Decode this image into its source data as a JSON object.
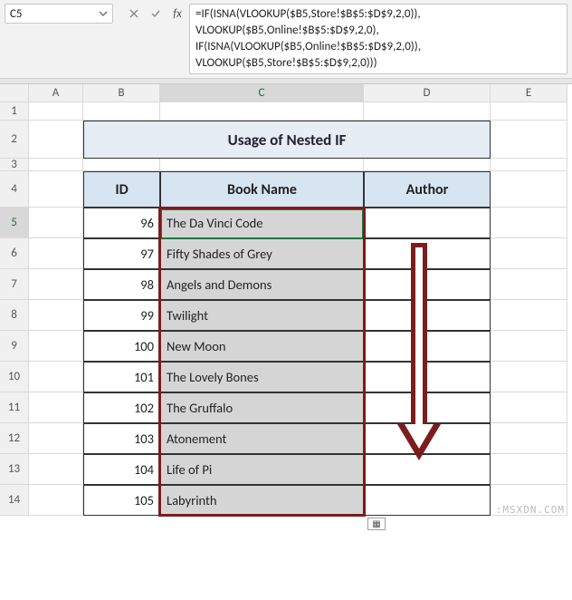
{
  "formula_bar": {
    "cell_ref": "C5",
    "formula": "=IF(ISNA(VLOOKUP($B5,Store!$B$5:$D$9,2,0)),\nVLOOKUP($B5,Online!$B$5:$D$9,2,0),\nIF(ISNA(VLOOKUP($B5,Online!$B$5:$D$9,2,0)),\nVLOOKUP($B5,Store!$B$5:$D$9,2,0)))"
  },
  "columns": [
    "A",
    "B",
    "C",
    "D",
    "E"
  ],
  "row_labels": [
    "1",
    "2",
    "3",
    "4",
    "5",
    "6",
    "7",
    "8",
    "9",
    "10",
    "11",
    "12",
    "13",
    "14"
  ],
  "title": "Usage of Nested IF",
  "headers": {
    "id": "ID",
    "name": "Book Name",
    "author": "Author"
  },
  "rows": [
    {
      "id": "96",
      "name": "The Da Vinci Code"
    },
    {
      "id": "97",
      "name": "Fifty Shades of Grey"
    },
    {
      "id": "98",
      "name": "Angels and Demons"
    },
    {
      "id": "99",
      "name": "Twilight"
    },
    {
      "id": "100",
      "name": "New Moon"
    },
    {
      "id": "101",
      "name": "The Lovely Bones"
    },
    {
      "id": "102",
      "name": "The Gruffalo"
    },
    {
      "id": "103",
      "name": "Atonement"
    },
    {
      "id": "104",
      "name": "Life of Pi"
    },
    {
      "id": "105",
      "name": "Labyrinth"
    }
  ],
  "watermark": ":MSXDN.COM"
}
